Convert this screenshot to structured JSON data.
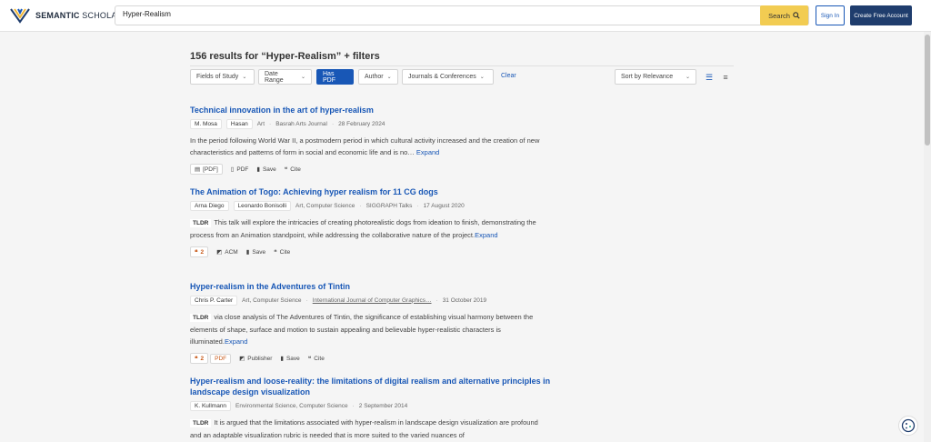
{
  "header": {
    "logo_bold": "SEMANTIC",
    "logo_rest": " SCHOLAR",
    "search_value": "Hyper-Realism",
    "search_btn": "Search",
    "signin": "Sign In",
    "create": "Create Free Account"
  },
  "results_title": "156 results for “Hyper-Realism” + filters",
  "filters": {
    "fields": "Fields of Study",
    "date": "Date Range",
    "haspdf": "Has PDF",
    "author": "Author",
    "journals": "Journals & Conferences",
    "clear": "Clear",
    "sort": "Sort by Relevance"
  },
  "results": [
    {
      "title": "Technical innovation in the art of hyper-realism",
      "authors": [
        "M. Mosa",
        "Hasan"
      ],
      "fields": "Art",
      "venue": "Basrah Arts Journal",
      "date": "28 February 2024",
      "abstract": "In the period following World War II, a postmodern period in which cultural activity increased and the creation of new characteristics and patterns of form in social and economic life and is no…",
      "expand": "Expand",
      "actions": {
        "pdf_bracket": "[PDF]",
        "pdf": "PDF",
        "save": "Save",
        "cite": "Cite"
      }
    },
    {
      "title": "The Animation of Togo: Achieving hyper realism for 11 CG dogs",
      "authors": [
        "Arna Diego",
        "Leonardo Bonisolli"
      ],
      "fields": "Art, Computer Science",
      "venue": "SIGGRAPH Talks",
      "date": "17 August 2020",
      "tldr": "TLDR",
      "abstract": "This talk will explore the intricacies of creating photorealistic dogs from ideation to finish, demonstrating the process from an Animation standpoint, while addressing the collaborative nature of the project.",
      "expand": "Expand",
      "actions": {
        "cites": "2",
        "acm": "ACM",
        "save": "Save",
        "cite": "Cite"
      }
    },
    {
      "title": "Hyper-realism in the Adventures of Tintin",
      "authors": [
        "Chris P. Carter"
      ],
      "fields": "Art, Computer Science",
      "venue": "International Journal of Computer Graphics…",
      "date": "31 October 2019",
      "tldr": "TLDR",
      "abstract": "via close analysis of The Adventures of Tintin, the significance of establishing visual harmony between the elements of shape, surface and motion to sustain appealing and believable hyper-realistic characters is illuminated.",
      "expand": "Expand",
      "actions": {
        "cites": "2",
        "pdf": "PDF",
        "publisher": "Publisher",
        "save": "Save",
        "cite": "Cite"
      }
    },
    {
      "title": "Hyper-realism and loose-reality: the limitations of digital realism and alternative principles in landscape design visualization",
      "authors": [
        "K. Kullmann"
      ],
      "fields": "Environmental Science, Computer Science",
      "date": "2 September 2014",
      "tldr": "TLDR",
      "abstract": "It is argued that the limitations associated with hyper-realism in landscape design visualization are profound and an adaptable visualization rubric is needed that is more suited to the varied nuances of"
    }
  ]
}
